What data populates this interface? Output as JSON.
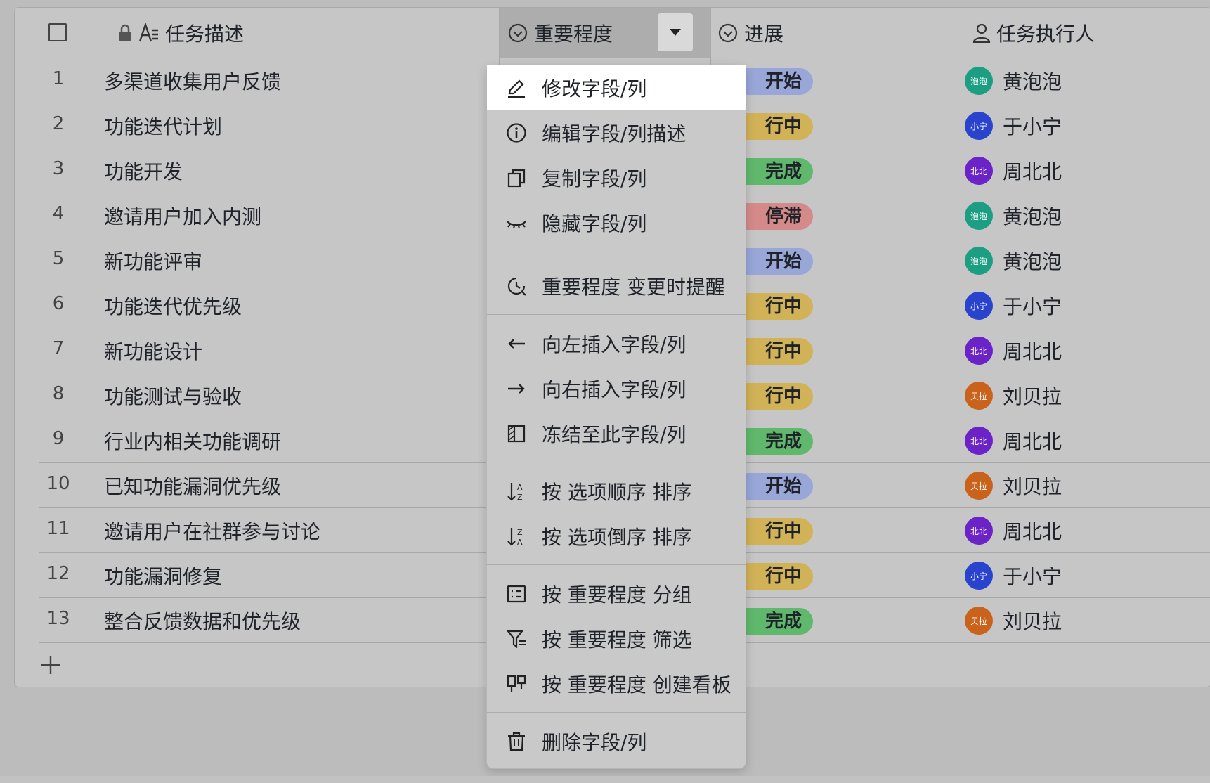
{
  "columns": {
    "description": "任务描述",
    "importance": "重要程度",
    "progress": "进展",
    "assignee": "任务执行人"
  },
  "rows": [
    {
      "num": "1",
      "desc": "多渠道收集用户反馈",
      "progress": "开始",
      "progress_color": "#98a6d8",
      "person": "黄泡泡",
      "avatar": "泡泡",
      "avatar_color": "#1c9e83"
    },
    {
      "num": "2",
      "desc": "功能迭代计划",
      "progress": "行中",
      "progress_color": "#d2b257",
      "person": "于小宁",
      "avatar": "小宁",
      "avatar_color": "#2a43cc"
    },
    {
      "num": "3",
      "desc": "功能开发",
      "progress": "完成",
      "progress_color": "#5fb86c",
      "person": "周北北",
      "avatar": "北北",
      "avatar_color": "#6b22c6"
    },
    {
      "num": "4",
      "desc": "邀请用户加入内测",
      "progress": "停滞",
      "progress_color": "#d58a8a",
      "person": "黄泡泡",
      "avatar": "泡泡",
      "avatar_color": "#1c9e83"
    },
    {
      "num": "5",
      "desc": "新功能评审",
      "progress": "开始",
      "progress_color": "#98a6d8",
      "person": "黄泡泡",
      "avatar": "泡泡",
      "avatar_color": "#1c9e83"
    },
    {
      "num": "6",
      "desc": "功能迭代优先级",
      "progress": "行中",
      "progress_color": "#d2b257",
      "person": "于小宁",
      "avatar": "小宁",
      "avatar_color": "#2a43cc"
    },
    {
      "num": "7",
      "desc": "新功能设计",
      "progress": "行中",
      "progress_color": "#d2b257",
      "person": "周北北",
      "avatar": "北北",
      "avatar_color": "#6b22c6"
    },
    {
      "num": "8",
      "desc": "功能测试与验收",
      "progress": "行中",
      "progress_color": "#d2b257",
      "person": "刘贝拉",
      "avatar": "贝拉",
      "avatar_color": "#c9631c"
    },
    {
      "num": "9",
      "desc": "行业内相关功能调研",
      "progress": "完成",
      "progress_color": "#5fb86c",
      "person": "周北北",
      "avatar": "北北",
      "avatar_color": "#6b22c6"
    },
    {
      "num": "10",
      "desc": "已知功能漏洞优先级",
      "progress": "开始",
      "progress_color": "#98a6d8",
      "person": "刘贝拉",
      "avatar": "贝拉",
      "avatar_color": "#c9631c"
    },
    {
      "num": "11",
      "desc": "邀请用户在社群参与讨论",
      "progress": "行中",
      "progress_color": "#d2b257",
      "person": "周北北",
      "avatar": "北北",
      "avatar_color": "#6b22c6"
    },
    {
      "num": "12",
      "desc": "功能漏洞修复",
      "progress": "行中",
      "progress_color": "#d2b257",
      "person": "于小宁",
      "avatar": "小宁",
      "avatar_color": "#2a43cc"
    },
    {
      "num": "13",
      "desc": "整合反馈数据和优先级",
      "progress": "完成",
      "progress_color": "#5fb86c",
      "person": "刘贝拉",
      "avatar": "贝拉",
      "avatar_color": "#c9631c"
    }
  ],
  "menu": {
    "edit_field": "修改字段/列",
    "edit_description": "编辑字段/列描述",
    "duplicate_field": "复制字段/列",
    "hide_field": "隐藏字段/列",
    "notify_on_change": "重要程度 变更时提醒",
    "insert_left": "向左插入字段/列",
    "insert_right": "向右插入字段/列",
    "freeze_to_here": "冻结至此字段/列",
    "sort_ascending": "按 选项顺序 排序",
    "sort_descending": "按 选项倒序 排序",
    "group_by": "按 重要程度 分组",
    "filter_by": "按 重要程度 筛选",
    "create_kanban": "按 重要程度 创建看板",
    "delete_field": "删除字段/列"
  }
}
